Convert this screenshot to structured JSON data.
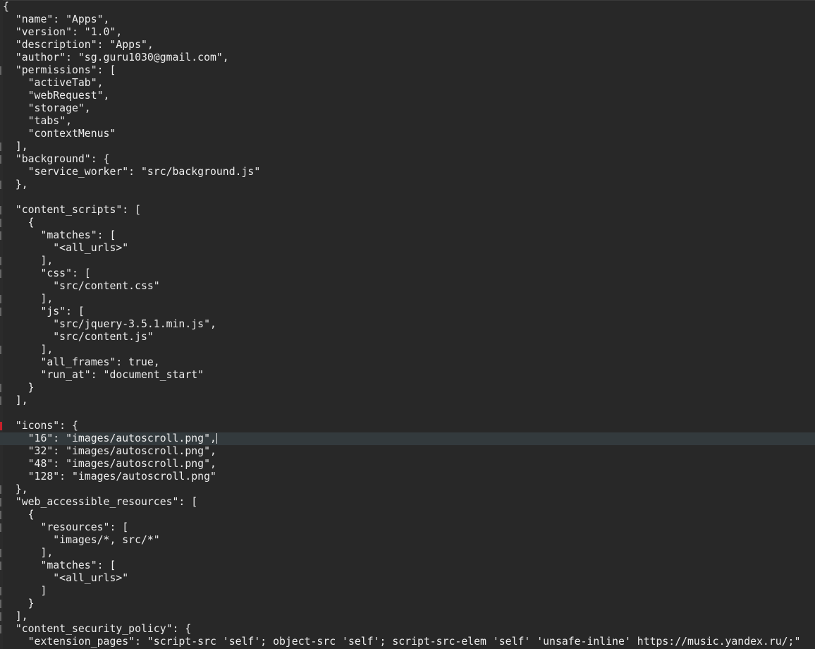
{
  "editor": {
    "cursor_line": 34,
    "lines": [
      {
        "text": "{",
        "marker": "none"
      },
      {
        "text": "  \"name\": \"Apps\",",
        "marker": "none"
      },
      {
        "text": "  \"version\": \"1.0\",",
        "marker": "none"
      },
      {
        "text": "  \"description\": \"Apps\",",
        "marker": "none"
      },
      {
        "text": "  \"author\": \"sg.guru1030@gmail.com\",",
        "marker": "none"
      },
      {
        "text": "  \"permissions\": [",
        "marker": "fold"
      },
      {
        "text": "    \"activeTab\",",
        "marker": "none"
      },
      {
        "text": "    \"webRequest\",",
        "marker": "none"
      },
      {
        "text": "    \"storage\",",
        "marker": "none"
      },
      {
        "text": "    \"tabs\",",
        "marker": "none"
      },
      {
        "text": "    \"contextMenus\"",
        "marker": "none"
      },
      {
        "text": "  ],",
        "marker": "fold"
      },
      {
        "text": "  \"background\": {",
        "marker": "fold"
      },
      {
        "text": "    \"service_worker\": \"src/background.js\"",
        "marker": "none"
      },
      {
        "text": "  },",
        "marker": "fold"
      },
      {
        "text": "",
        "marker": "none"
      },
      {
        "text": "  \"content_scripts\": [",
        "marker": "fold"
      },
      {
        "text": "    {",
        "marker": "fold"
      },
      {
        "text": "      \"matches\": [",
        "marker": "fold"
      },
      {
        "text": "        \"<all_urls>\"",
        "marker": "none"
      },
      {
        "text": "      ],",
        "marker": "fold"
      },
      {
        "text": "      \"css\": [",
        "marker": "fold"
      },
      {
        "text": "        \"src/content.css\"",
        "marker": "none"
      },
      {
        "text": "      ],",
        "marker": "fold"
      },
      {
        "text": "      \"js\": [",
        "marker": "fold"
      },
      {
        "text": "        \"src/jquery-3.5.1.min.js\",",
        "marker": "none"
      },
      {
        "text": "        \"src/content.js\"",
        "marker": "none"
      },
      {
        "text": "      ],",
        "marker": "fold"
      },
      {
        "text": "      \"all_frames\": true,",
        "marker": "none"
      },
      {
        "text": "      \"run_at\": \"document_start\"",
        "marker": "none"
      },
      {
        "text": "    }",
        "marker": "fold"
      },
      {
        "text": "  ],",
        "marker": "fold"
      },
      {
        "text": "",
        "marker": "none"
      },
      {
        "text": "  \"icons\": {",
        "marker": "red"
      },
      {
        "text": "    \"16\": \"images/autoscroll.png\",",
        "marker": "none"
      },
      {
        "text": "    \"32\": \"images/autoscroll.png\",",
        "marker": "none"
      },
      {
        "text": "    \"48\": \"images/autoscroll.png\",",
        "marker": "none"
      },
      {
        "text": "    \"128\": \"images/autoscroll.png\"",
        "marker": "none"
      },
      {
        "text": "  },",
        "marker": "fold"
      },
      {
        "text": "  \"web_accessible_resources\": [",
        "marker": "fold"
      },
      {
        "text": "    {",
        "marker": "fold"
      },
      {
        "text": "      \"resources\": [",
        "marker": "fold"
      },
      {
        "text": "        \"images/*, src/*\"",
        "marker": "none"
      },
      {
        "text": "      ],",
        "marker": "fold"
      },
      {
        "text": "      \"matches\": [",
        "marker": "fold"
      },
      {
        "text": "        \"<all_urls>\"",
        "marker": "none"
      },
      {
        "text": "      ]",
        "marker": "fold"
      },
      {
        "text": "    }",
        "marker": "fold"
      },
      {
        "text": "  ],",
        "marker": "fold"
      },
      {
        "text": "  \"content_security_policy\": {",
        "marker": "fold"
      },
      {
        "text": "    \"extension_pages\": \"script-src 'self'; object-src 'self'; script-src-elem 'self' 'unsafe-inline' https://music.yandex.ru/;\"",
        "marker": "none"
      }
    ]
  }
}
